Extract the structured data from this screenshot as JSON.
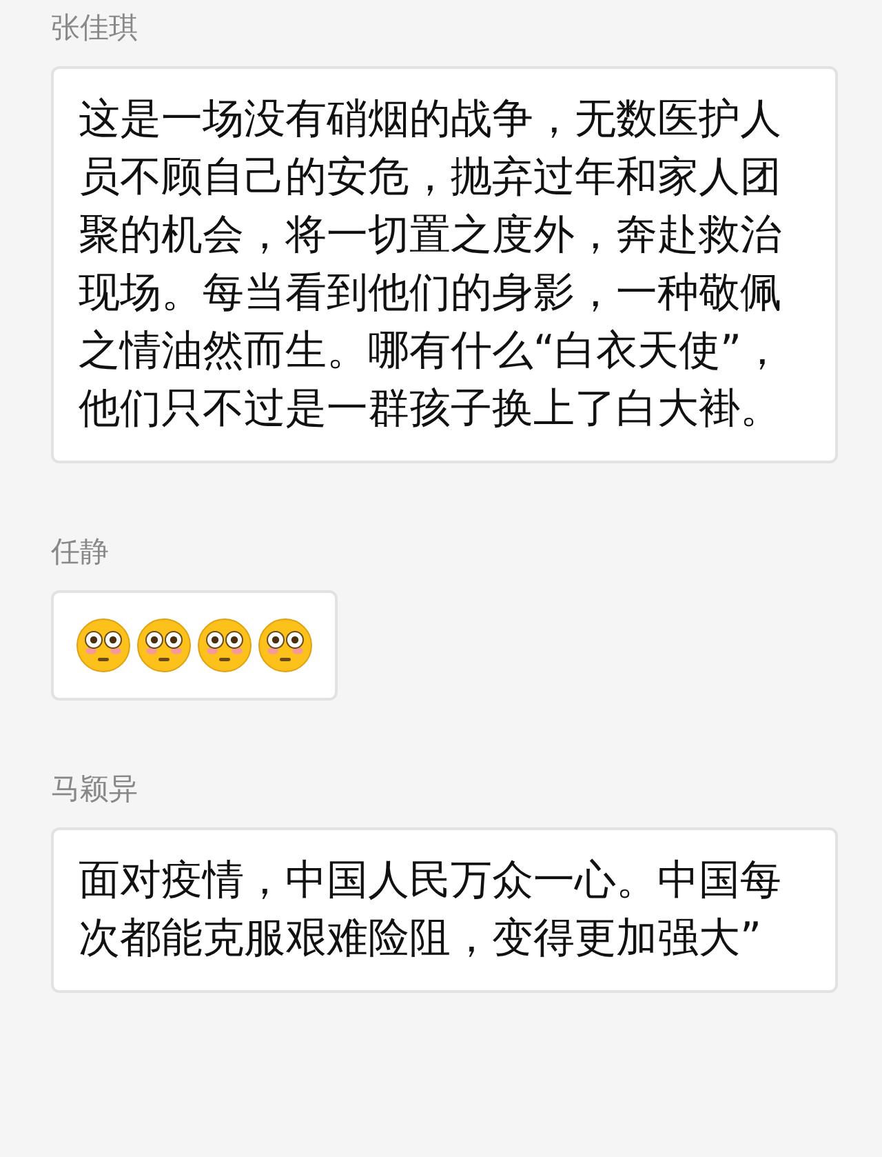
{
  "messages": [
    {
      "sender": "张佳琪",
      "kind": "text",
      "text": "这是一场没有硝烟的战争，无数医护人员不顾自己的安危，抛弃过年和家人团聚的机会，将一切置之度外，奔赴救治现场。每当看到他们的身影，一种敬佩之情油然而生。哪有什么“白衣天使”，他们只不过是一群孩子换上了白大褂。"
    },
    {
      "sender": "任静",
      "kind": "emoji",
      "emojis": [
        {
          "kind": "flushed"
        },
        {
          "kind": "flushed"
        },
        {
          "kind": "flushed"
        },
        {
          "kind": "flushed"
        }
      ]
    },
    {
      "sender": "马颖异",
      "kind": "text",
      "text": "面对疫情，中国人民万众一心。中国每次都能克服艰难险阻，变得更加强大”"
    }
  ]
}
